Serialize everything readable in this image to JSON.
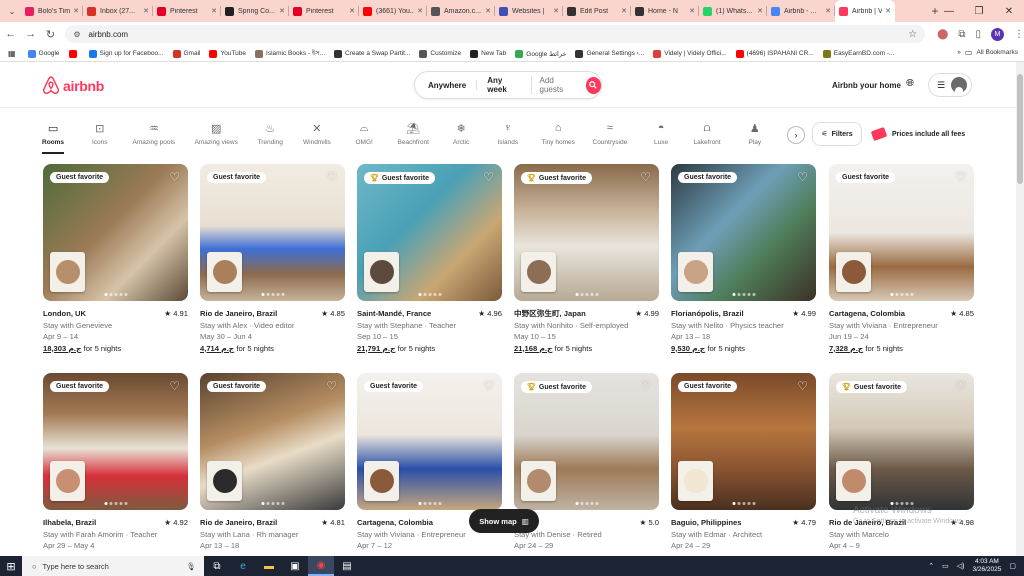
{
  "browser": {
    "tabs": [
      {
        "title": "Bolo's Tim",
        "color": "#e91e63"
      },
      {
        "title": "Inbox (27...",
        "color": "#d93025"
      },
      {
        "title": "Pinterest",
        "color": "#e60023"
      },
      {
        "title": "Spring Co...",
        "color": "#222222"
      },
      {
        "title": "Pinterest",
        "color": "#e60023"
      },
      {
        "title": "(3661) You...",
        "color": "#ff0000"
      },
      {
        "title": "Amazon.c...",
        "color": "#555555"
      },
      {
        "title": "Websites |",
        "color": "#3f51b5"
      },
      {
        "title": "Edit Post",
        "color": "#333333"
      },
      {
        "title": "Home - N",
        "color": "#333333"
      },
      {
        "title": "(1) Whats...",
        "color": "#25d366"
      },
      {
        "title": "Airbnb - ...",
        "color": "#4285f4"
      },
      {
        "title": "Airbnb | V",
        "color": "#ff385c"
      }
    ],
    "url": "airbnb.com",
    "profile_initial": "M",
    "bookmarks": [
      {
        "label": "Google",
        "color": "#4285f4"
      },
      {
        "label": "",
        "color": "#ff0000"
      },
      {
        "label": "Sign up for Faceboo...",
        "color": "#1877f2"
      },
      {
        "label": "Gmail",
        "color": "#d93025"
      },
      {
        "label": "YouTube",
        "color": "#ff0000"
      },
      {
        "label": "Islamic Books - ইস...",
        "color": "#8d6e63"
      },
      {
        "label": "Create a Swap Partit...",
        "color": "#333333"
      },
      {
        "label": "Customize",
        "color": "#555555"
      },
      {
        "label": "New Tab",
        "color": "#222222"
      },
      {
        "label": "Google خرائط",
        "color": "#34a853"
      },
      {
        "label": "General Settings ‹...",
        "color": "#333333"
      },
      {
        "label": "Videly | Videly Offici...",
        "color": "#e53935"
      },
      {
        "label": "(4696) ISPAHANI CR...",
        "color": "#ff0000"
      },
      {
        "label": "EasyEarnBD.com -...",
        "color": "#827717"
      }
    ],
    "all_bookmarks": "All Bookmarks"
  },
  "header": {
    "brand": "airbnb",
    "search": {
      "anywhere": "Anywhere",
      "week": "Any week",
      "guests": "Add guests"
    },
    "host_link": "Airbnb your home"
  },
  "categories": [
    {
      "label": "Rooms",
      "icon": "bed-icon",
      "glyph": "▭"
    },
    {
      "label": "Icons",
      "icon": "icons-icon",
      "glyph": "⊡"
    },
    {
      "label": "Amazing pools",
      "icon": "pool-icon",
      "glyph": "♒"
    },
    {
      "label": "Amazing views",
      "icon": "views-icon",
      "glyph": "▨"
    },
    {
      "label": "Trending",
      "icon": "flame-icon",
      "glyph": "♨"
    },
    {
      "label": "Windmills",
      "icon": "windmill-icon",
      "glyph": "✕"
    },
    {
      "label": "OMG!",
      "icon": "ufo-icon",
      "glyph": "⌓"
    },
    {
      "label": "Beachfront",
      "icon": "beach-icon",
      "glyph": "⛱"
    },
    {
      "label": "Arctic",
      "icon": "snowflake-icon",
      "glyph": "❄"
    },
    {
      "label": "Islands",
      "icon": "island-icon",
      "glyph": "♆"
    },
    {
      "label": "Tiny homes",
      "icon": "tiny-home-icon",
      "glyph": "⌂"
    },
    {
      "label": "Countryside",
      "icon": "countryside-icon",
      "glyph": "≈"
    },
    {
      "label": "Luxe",
      "icon": "luxe-icon",
      "glyph": "◓"
    },
    {
      "label": "Lakefront",
      "icon": "lakefront-icon",
      "glyph": "⩍"
    },
    {
      "label": "Play",
      "icon": "play-icon",
      "glyph": "♟"
    }
  ],
  "filters_label": "Filters",
  "fees_label": "Prices include all fees",
  "badge_label": "Guest favorite",
  "listings": [
    {
      "location": "London, UK",
      "rating": "4.91",
      "host": "Stay with Genevieve",
      "dates": "Apr 9 – 14",
      "price": "18,303 ج.م",
      "nights": "for 5 nights",
      "trophy": false,
      "bg": "linear-gradient(135deg,#4e6b3a,#9b7a56 45%,#d6c3a8 70%,#5c4a37)",
      "face": "#b78e6a"
    },
    {
      "location": "Rio de Janeiro, Brazil",
      "rating": "4.85",
      "host": "Stay with Alex · Video editor",
      "dates": "May 30 – Jun 4",
      "price": "4,714 ج.م",
      "nights": "for 5 nights",
      "trophy": false,
      "bg": "linear-gradient(180deg,#f1ece3 0%,#e8dfd1 45%,#3f6fd6 62%,#8b6a4e 80%,#c7b39a)",
      "face": "#a97f5c"
    },
    {
      "location": "Saint-Mandé, France",
      "rating": "4.96",
      "host": "Stay with Stephane · Teacher",
      "dates": "Sep 10 – 15",
      "price": "21,791 ج.م",
      "nights": "for 5 nights",
      "trophy": true,
      "bg": "linear-gradient(135deg,#6fb8c9 0%,#4aa0b5 40%,#c9a774 70%,#7b5a3c)",
      "face": "#5c4a3c"
    },
    {
      "location": "中野区弥生町, Japan",
      "rating": "4.99",
      "host": "Stay with Norihito · Self-employed",
      "dates": "May 10 – 15",
      "price": "21,168 ج.م",
      "nights": "for 5 nights",
      "trophy": true,
      "bg": "linear-gradient(180deg,#8a6a4a 0%,#c8b59c 35%,#e9e4db 60%,#b7aa96)",
      "face": "#8c6e55"
    },
    {
      "location": "Florianópolis, Brazil",
      "rating": "4.99",
      "host": "Stay with Nelito · Physics teacher",
      "dates": "Apr 13 – 18",
      "price": "9,530 ج.م",
      "nights": "for 5 nights",
      "trophy": false,
      "bg": "linear-gradient(135deg,#2d3a40 0%,#6e9fb8 40%,#4f7d5a 65%,#3b3126)",
      "face": "#c9a184"
    },
    {
      "location": "Cartagena, Colombia",
      "rating": "4.85",
      "host": "Stay with Viviana · Entrepreneur",
      "dates": "Jun 19 – 24",
      "price": "7,328 ج.م",
      "nights": "for 5 nights",
      "trophy": false,
      "bg": "linear-gradient(180deg,#f3f1ee 0%,#ece7e0 50%,#9a6b42 75%,#d8c9b6)",
      "face": "#8a5a3a"
    },
    {
      "location": "Ilhabela, Brazil",
      "rating": "4.92",
      "host": "Stay with Farah Amorim · Teacher",
      "dates": "Apr 29 – May 4",
      "price": "",
      "nights": "",
      "trophy": false,
      "bg": "linear-gradient(180deg,#6b4a32 0%,#a47a55 30%,#e8e2d6 55%,#d7303a 75%,#7d5b40)",
      "face": "#c98f72"
    },
    {
      "location": "Rio de Janeiro, Brazil",
      "rating": "4.81",
      "host": "Stay with Lana · Rh manager",
      "dates": "Apr 13 – 18",
      "price": "",
      "nights": "",
      "trophy": false,
      "bg": "linear-gradient(160deg,#5a4330 0%,#b58d62 40%,#e8dcc7 60%,#3a3a3a)",
      "face": "#2b2b2b"
    },
    {
      "location": "Cartagena, Colombia",
      "rating": "",
      "host": "Stay with Viviana · Entrepreneur",
      "dates": "Apr 7 – 12",
      "price": "",
      "nights": "",
      "trophy": false,
      "bg": "linear-gradient(180deg,#f4f1ec 0%,#ece6dd 45%,#2a4fa8 70%,#c6a77f)",
      "face": "#8a5a3a"
    },
    {
      "location": "Brazil",
      "rating": "5.0",
      "host": "Stay with Denise · Retired",
      "dates": "Apr 24 – 29",
      "price": "",
      "nights": "",
      "trophy": true,
      "bg": "linear-gradient(180deg,#e6e3de 0%,#d9d5ce 45%,#9d7a58 70%,#bfb3a3)",
      "face": "#b38a6c"
    },
    {
      "location": "Baguio, Philippines",
      "rating": "4.79",
      "host": "Stay with Edmar · Architect",
      "dates": "Apr 24 – 29",
      "price": "",
      "nights": "",
      "trophy": false,
      "bg": "linear-gradient(180deg,#7a4a2a 0%,#b8763e 40%,#8a5431 70%,#4a3020)",
      "face": "#f1e6d2"
    },
    {
      "location": "Rio de Janeiro, Brazil",
      "rating": "4.98",
      "host": "Stay with Marcelo",
      "dates": "Apr 4 – 9",
      "price": "",
      "nights": "",
      "trophy": true,
      "bg": "linear-gradient(180deg,#e9e6e0 0%,#d4c9b8 40%,#6d5a48 70%,#2f3436)",
      "face": "#c08b6a"
    }
  ],
  "show_map": "Show map",
  "windows_watermark": {
    "title": "Activate Windows",
    "subtitle": "Go to Settings to activate Windows."
  },
  "taskbar": {
    "search_placeholder": "Type here to search",
    "time": "4:03 AM",
    "date": "3/26/2025"
  }
}
